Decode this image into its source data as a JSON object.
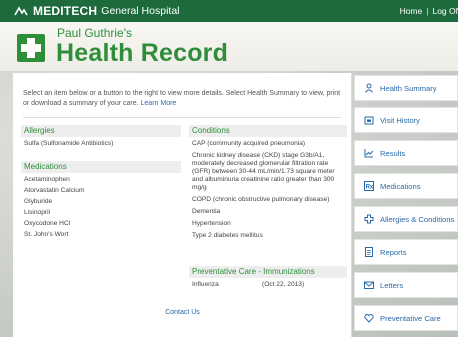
{
  "header": {
    "brand": "MEDITECH",
    "hospital": "General Hospital",
    "links": [
      "Home",
      "|",
      "Log Of"
    ]
  },
  "title": {
    "patient_name": "Paul Guthrie's",
    "record_title": "Health Record"
  },
  "intro": {
    "text": "Select an item below or a button to the right to view more details. Select Health Summary to view, print or download a summary of your care.",
    "link": "Learn More"
  },
  "allergies": {
    "heading": "Allergies",
    "items": [
      "Sulfa (Sulfonamide Antibiotics)"
    ]
  },
  "medications": {
    "heading": "Medications",
    "items": [
      "Acetaminophen",
      "Atorvastatin Calcium",
      "Glyburide",
      "Lisinopril",
      "Oxycodone HCl",
      "St. John's Wort"
    ]
  },
  "conditions": {
    "heading": "Conditions",
    "items": [
      "CAP (community acquired pneumonia)",
      "Chronic kidney disease (CKD) stage G3b/A1, moderately decreased glomerular filtration rate (GFR) between 30-44 mL/min/1.73 square meter and albuminuria creatinine ratio greater than 300 mg/g",
      "COPD (chronic obstructive pulmonary disease)",
      "Dementia",
      "Hypertension",
      "Type 2 diabetes mellitus"
    ]
  },
  "preventive": {
    "heading": "Preventative Care - Immunizations",
    "rows": [
      {
        "name": "Influenza",
        "date": "(Oct 22, 2013)"
      }
    ]
  },
  "contact": "Contact Us",
  "sidebar": {
    "items": [
      {
        "label": "Health Summary",
        "icon": "person-icon"
      },
      {
        "label": "Visit History",
        "icon": "calendar-icon"
      },
      {
        "label": "Results",
        "icon": "chart-line-icon"
      },
      {
        "label": "Medications",
        "icon": "rx-icon"
      },
      {
        "label": "Allergies & Conditions",
        "icon": "medical-cross-icon"
      },
      {
        "label": "Reports",
        "icon": "document-icon"
      },
      {
        "label": "Letters",
        "icon": "envelope-icon"
      },
      {
        "label": "Preventative Care",
        "icon": "heart-icon"
      }
    ]
  },
  "colors": {
    "header_green": "#1d6a3c",
    "title_green": "#2f8e3a",
    "link_blue": "#2a6aa8"
  }
}
